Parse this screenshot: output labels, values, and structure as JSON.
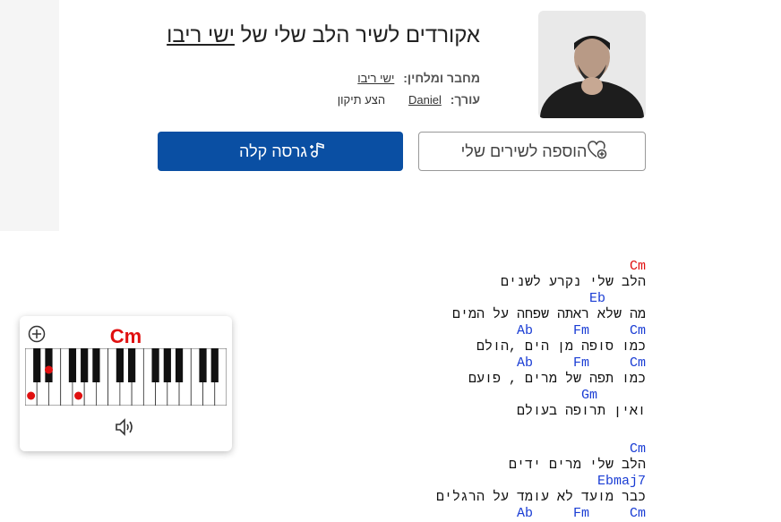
{
  "song": {
    "title_prefix": "אקורדים לשיר הלב שלי של",
    "artist": "ישי ריבו"
  },
  "meta": {
    "composer_label": "מחבר ומלחין:",
    "composer": "ישי ריבו",
    "editor_label": "עורך:",
    "editor": "Daniel",
    "suggest_fix": "הצע תיקון"
  },
  "buttons": {
    "easy_version": "גרסה קלה",
    "add_to_my_songs": "הוספה לשירים שלי"
  },
  "piano": {
    "chord": "Cm",
    "highlight_color": "#e01010"
  },
  "colors": {
    "primary": "#0a4fa3",
    "chord": "#1a3dd4",
    "first_chord": "#e01010"
  },
  "lyrics": [
    {
      "chords": "Cm",
      "text": "הלב שלי נקרע לשנים"
    },
    {
      "chords": "     Eb",
      "text": "מה שלא ראתה שפחה על המים"
    },
    {
      "chords": "Ab     Fm     Cm",
      "text": "כמו סופה מן הים ,הולם"
    },
    {
      "chords": "Ab     Fm     Cm",
      "text": "כמו תפה של מרים , פועם"
    },
    {
      "chords": "      Gm",
      "text": "ואין תרופה בעולם"
    },
    {
      "chords": "Cm",
      "text": "הלב שלי מרים ידים"
    },
    {
      "chords": "Ebmaj7   ",
      "text": "כבר מועד לא עומד על הרגלים"
    },
    {
      "chords": "Ab     Fm     Cm",
      "text": ""
    }
  ]
}
